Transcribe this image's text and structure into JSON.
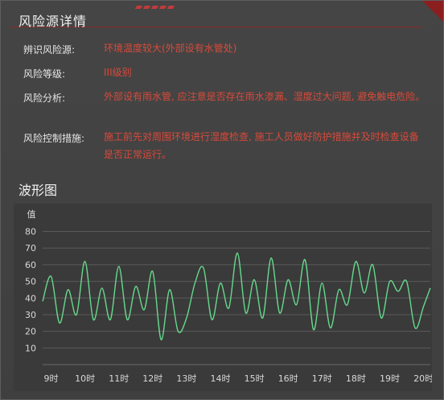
{
  "header": {
    "title": "风险源详情"
  },
  "details": [
    {
      "label": "辨识风险源:",
      "value": "环境温度较大(外部设有水管处)"
    },
    {
      "label": "风险等级:",
      "value": "III级别"
    },
    {
      "label": "风险分析:",
      "value": "外部设有雨水管, 应注意是否存在雨水渗漏、湿度过大问题, 避免触电危险。"
    },
    {
      "label": "风险控制措施:",
      "value": "施工前先对周围环境进行湿度检查, 施工人员做好防护措施并及时检查设备是否正常运行。"
    }
  ],
  "waveform_title": "波形图",
  "colors": {
    "accent_red": "#d94a3a",
    "line": "#66d98c",
    "title_line": "#8a2a2a"
  },
  "chart_data": {
    "type": "line",
    "title": "",
    "ylabel": "值",
    "xlabel": "",
    "categories": [
      "9时",
      "10时",
      "11时",
      "12时",
      "13时",
      "14时",
      "15时",
      "16时",
      "17时",
      "18时",
      "19时",
      "20时"
    ],
    "yticks": [
      10,
      20,
      30,
      40,
      50,
      60,
      70,
      80
    ],
    "ylim": [
      0,
      88
    ],
    "grid": true,
    "series": [
      {
        "x": [
          8.75,
          9,
          9.25,
          9.5,
          9.75,
          10,
          10.25,
          10.5,
          10.75,
          11,
          11.25,
          11.5,
          11.75,
          12,
          12.25,
          12.5,
          12.75,
          13,
          13.25,
          13.5,
          13.75,
          14,
          14.25,
          14.5,
          14.75,
          15,
          15.25,
          15.5,
          15.75,
          16,
          16.25,
          16.5,
          16.75,
          17,
          17.25,
          17.5,
          17.75,
          18,
          18.25,
          18.5,
          18.75,
          19,
          19.25,
          19.5,
          19.75,
          20,
          20.2
        ],
        "values": [
          38,
          53,
          25,
          45,
          30,
          62,
          27,
          46,
          27,
          59,
          27,
          47,
          33,
          56,
          15,
          45,
          20,
          28,
          49,
          58,
          27,
          49,
          34,
          67,
          31,
          51,
          28,
          64,
          31,
          51,
          36,
          63,
          21,
          49,
          22,
          45,
          36,
          62,
          43,
          60,
          28,
          50,
          44,
          50,
          22,
          35,
          46
        ]
      }
    ]
  }
}
